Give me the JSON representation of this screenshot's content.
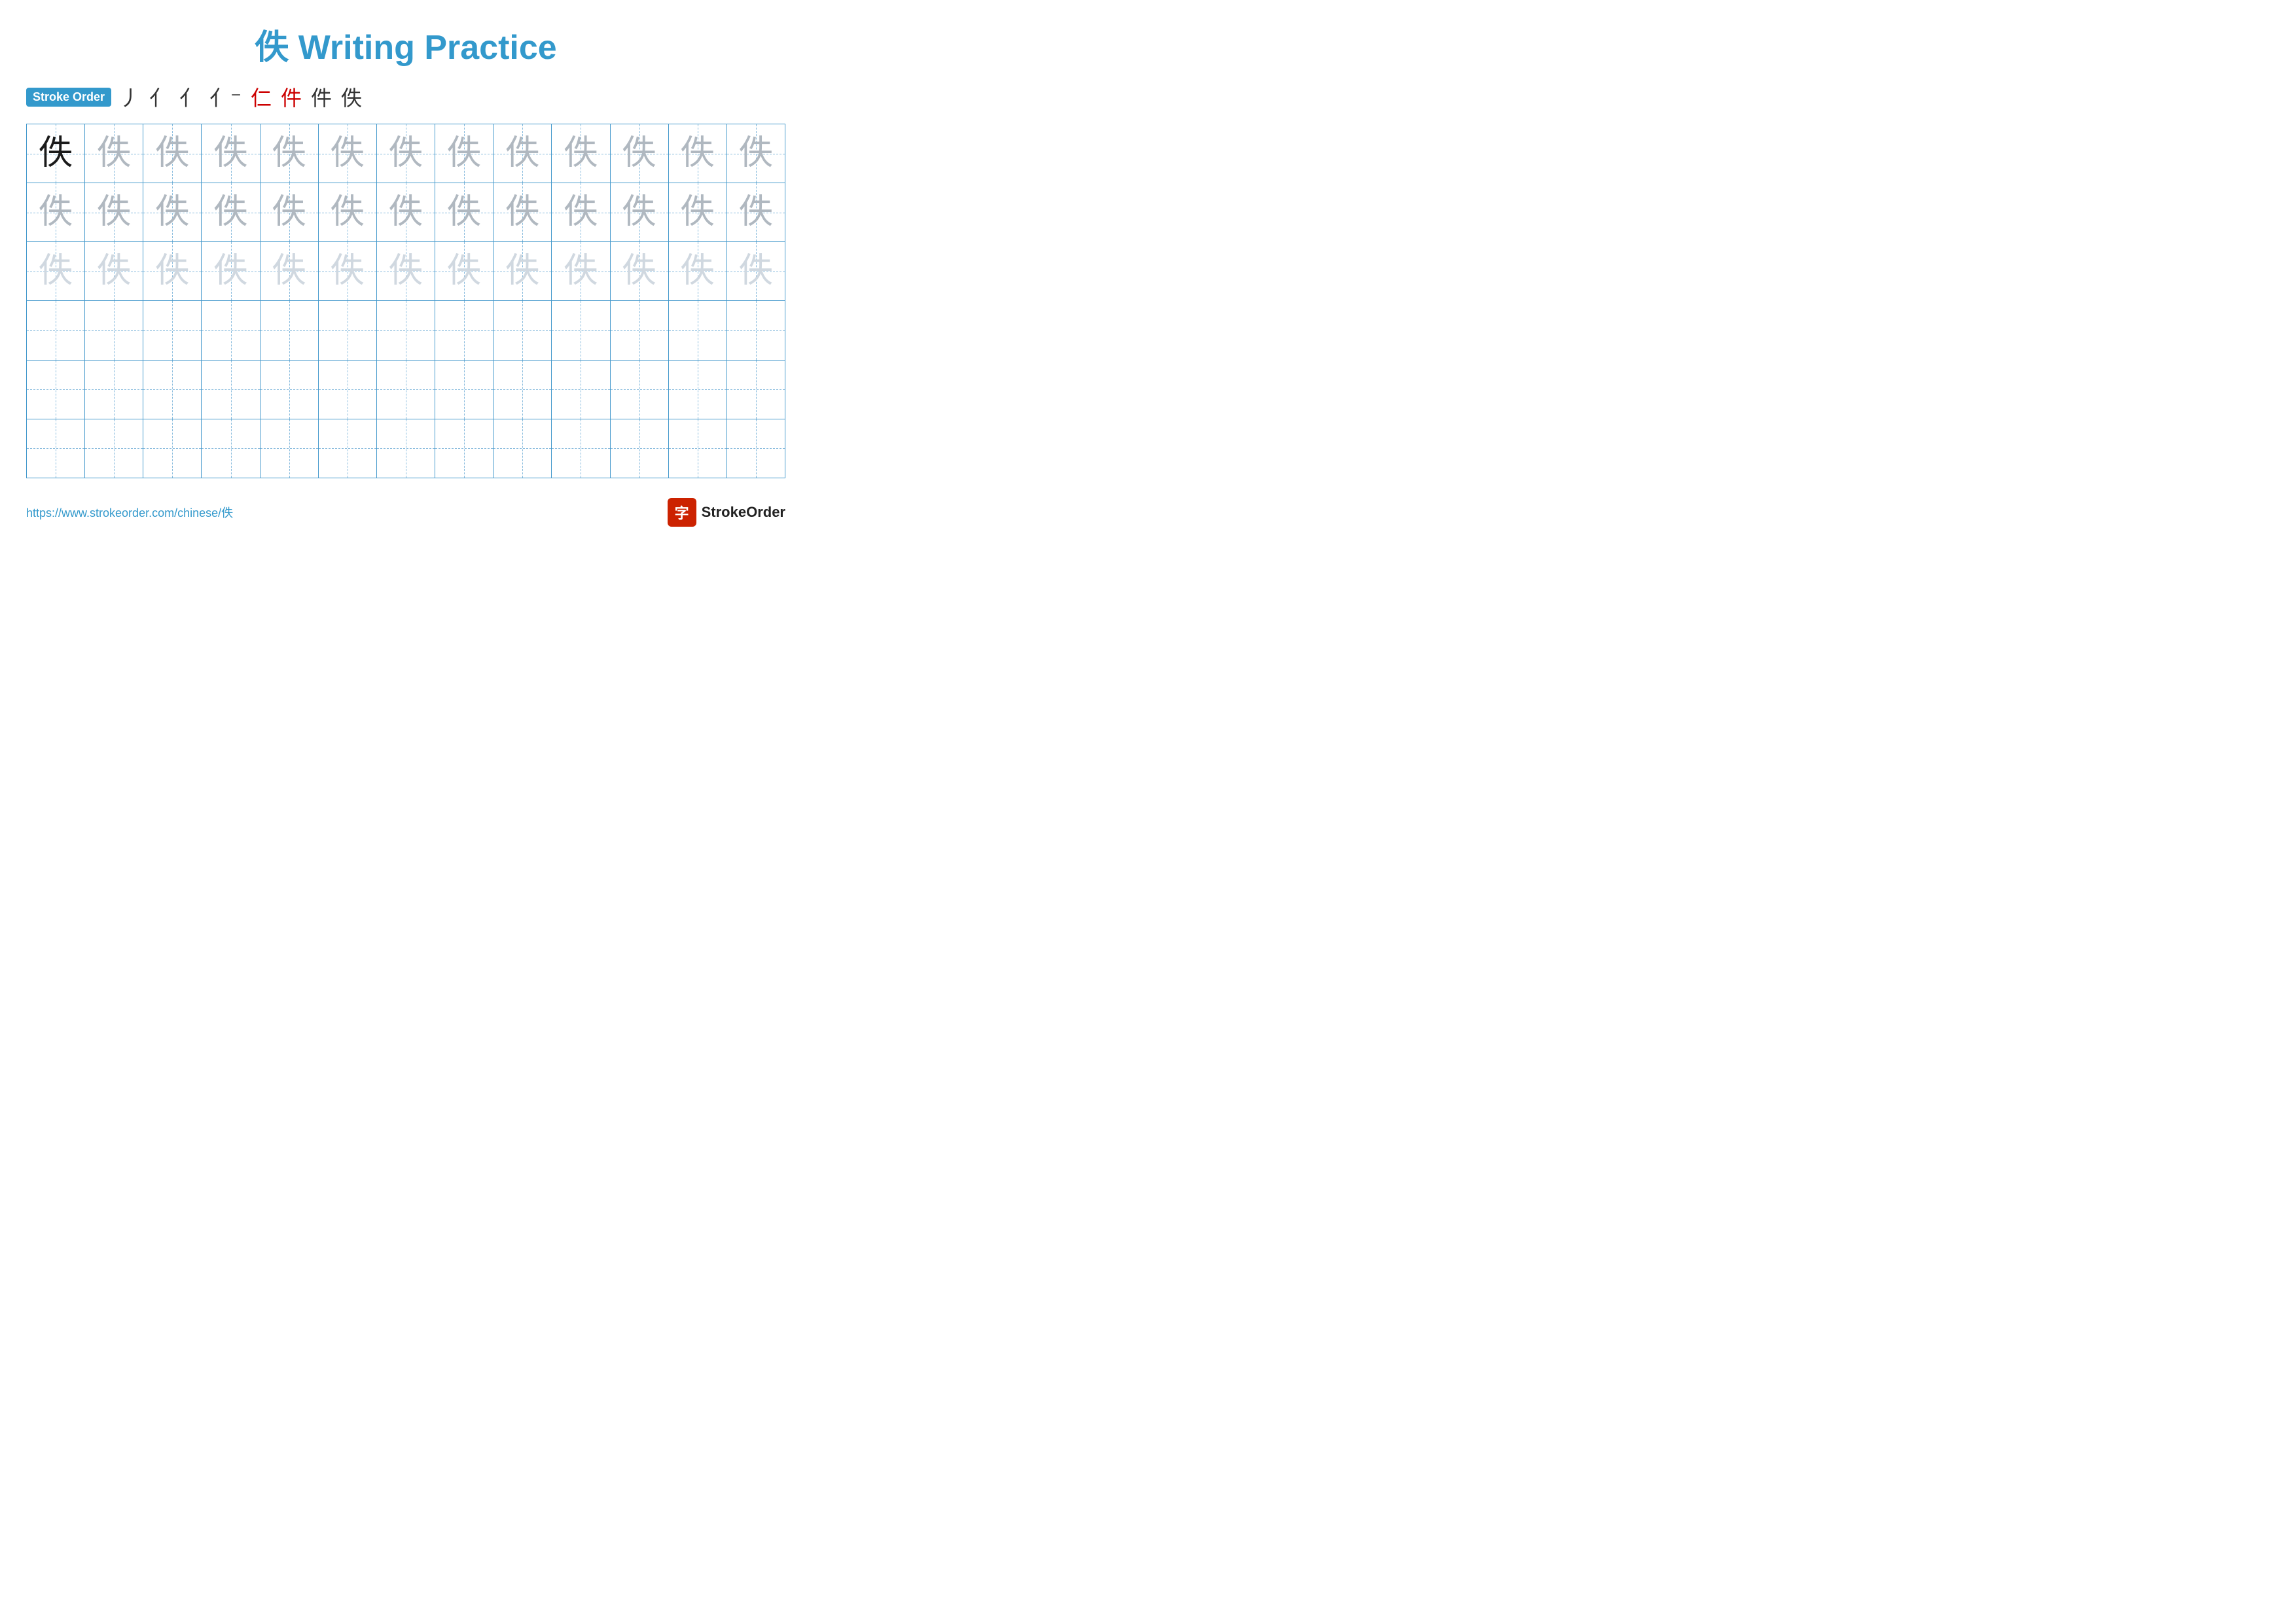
{
  "title": "佚 Writing Practice",
  "stroke_order": {
    "label": "Stroke Order",
    "strokes": [
      "丿",
      "亻",
      "亻",
      "亻⁻",
      "仁",
      "件",
      "件",
      "佚"
    ],
    "red_indices": [
      4,
      5
    ]
  },
  "character": "佚",
  "grid": {
    "rows": 6,
    "cols": 13
  },
  "row_styles": [
    "dark+medium",
    "medium",
    "light",
    "empty",
    "empty",
    "empty"
  ],
  "footer": {
    "url": "https://www.strokeorder.com/chinese/佚",
    "logo_char": "字",
    "logo_text": "StrokeOrder"
  }
}
